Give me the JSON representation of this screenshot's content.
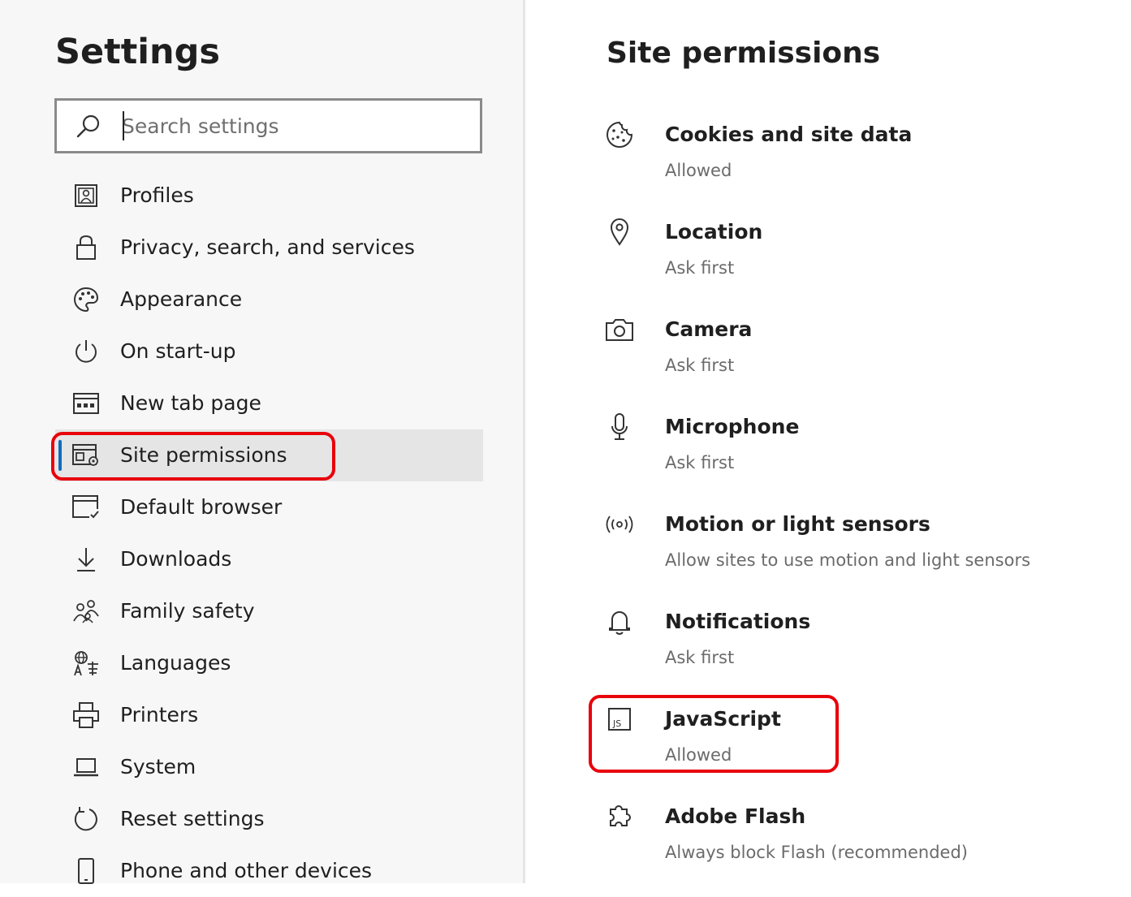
{
  "sidebar": {
    "title": "Settings",
    "search": {
      "placeholder": "Search settings",
      "value": ""
    },
    "items": [
      {
        "label": "Profiles",
        "icon": "profile-icon"
      },
      {
        "label": "Privacy, search, and services",
        "icon": "lock-icon"
      },
      {
        "label": "Appearance",
        "icon": "palette-icon"
      },
      {
        "label": "On start-up",
        "icon": "power-icon"
      },
      {
        "label": "New tab page",
        "icon": "new-tab-icon"
      },
      {
        "label": "Site permissions",
        "icon": "site-permissions-icon",
        "selected": true
      },
      {
        "label": "Default browser",
        "icon": "default-browser-icon"
      },
      {
        "label": "Downloads",
        "icon": "download-icon"
      },
      {
        "label": "Family safety",
        "icon": "family-icon"
      },
      {
        "label": "Languages",
        "icon": "languages-icon"
      },
      {
        "label": "Printers",
        "icon": "printer-icon"
      },
      {
        "label": "System",
        "icon": "laptop-icon"
      },
      {
        "label": "Reset settings",
        "icon": "reset-icon"
      },
      {
        "label": "Phone and other devices",
        "icon": "phone-icon"
      }
    ]
  },
  "main": {
    "title": "Site permissions",
    "permissions": [
      {
        "title": "Cookies and site data",
        "status": "Allowed",
        "icon": "cookie-icon"
      },
      {
        "title": "Location",
        "status": "Ask first",
        "icon": "location-icon"
      },
      {
        "title": "Camera",
        "status": "Ask first",
        "icon": "camera-icon"
      },
      {
        "title": "Microphone",
        "status": "Ask first",
        "icon": "microphone-icon"
      },
      {
        "title": "Motion or light sensors",
        "status": "Allow sites to use motion and light sensors",
        "icon": "sensor-icon"
      },
      {
        "title": "Notifications",
        "status": "Ask first",
        "icon": "bell-icon"
      },
      {
        "title": "JavaScript",
        "status": "Allowed",
        "icon": "javascript-icon"
      },
      {
        "title": "Adobe Flash",
        "status": "Always block Flash (recommended)",
        "icon": "puzzle-icon"
      }
    ]
  },
  "colors": {
    "accent": "#0f6cbd",
    "highlight": "#e8000b",
    "selected_bg": "#e5e5e5",
    "sidebar_bg": "#f7f7f7"
  }
}
